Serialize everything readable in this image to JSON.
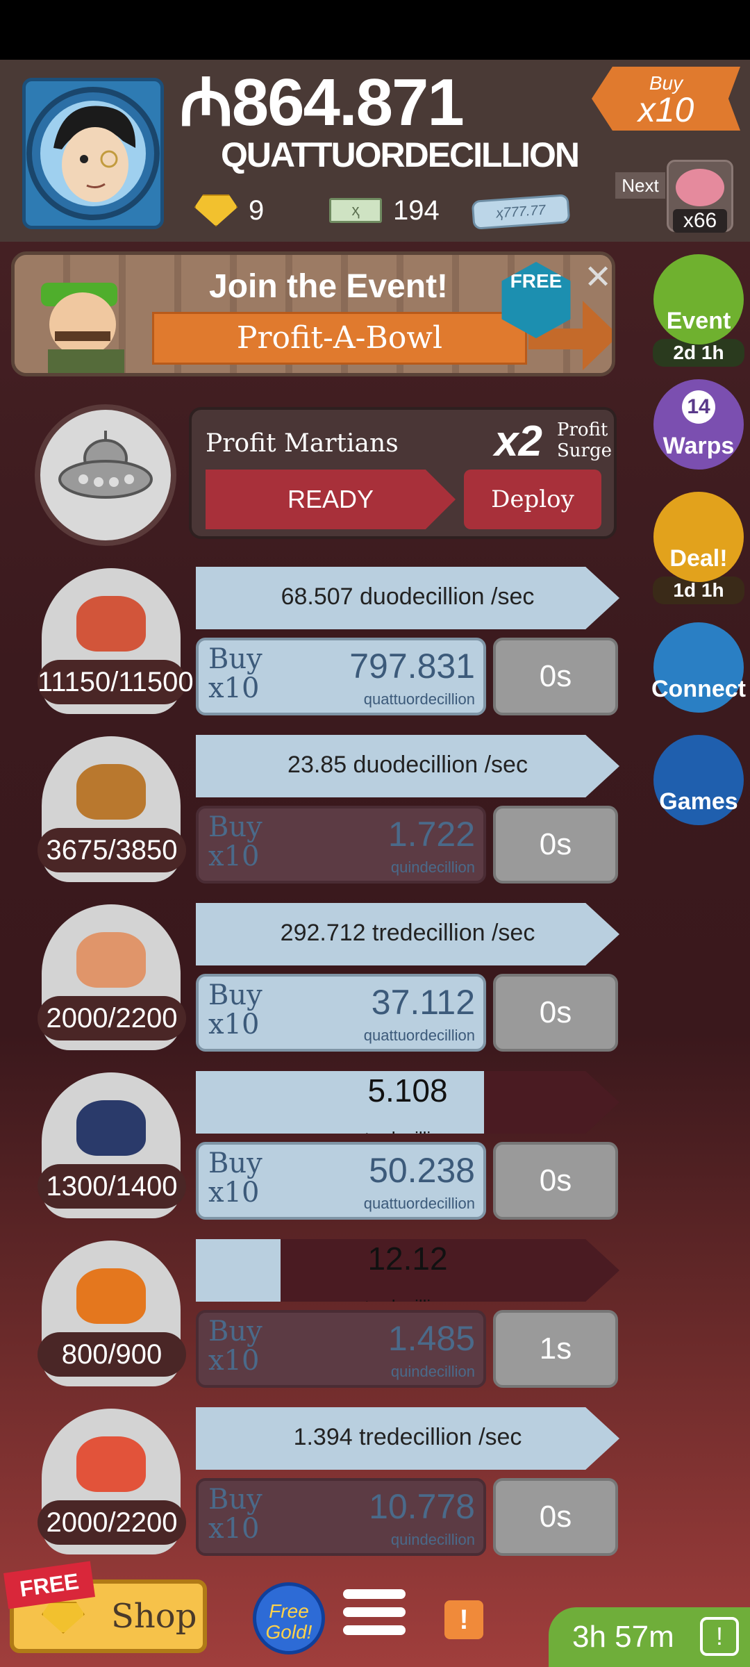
{
  "header": {
    "currency_symbol": "₼",
    "money_value": "864.871",
    "money_unit": "QUATTUORDECILLION",
    "gold_count": "9",
    "megabucks_count": "194",
    "angel_note": "ҳ777.77",
    "buy_multiplier_top": "Buy",
    "buy_multiplier_bottom": "x10",
    "next_label": "Next",
    "next_count": "x66"
  },
  "event_banner": {
    "title": "Join the Event!",
    "event_name": "Profit-A-Bowl",
    "free_label": "FREE",
    "close_glyph": "✕"
  },
  "side_buttons": [
    {
      "label": "Event",
      "timer": "2d 1h",
      "color": "#6fb12f"
    },
    {
      "label": "Warps",
      "badge": "14",
      "color": "#7b4fb0"
    },
    {
      "label": "Deal!",
      "timer": "1d 1h",
      "color": "#e2a21c"
    },
    {
      "label": "Connect",
      "color": "#2a7fc4"
    },
    {
      "label": "Games",
      "color": "#1f5fae"
    }
  ],
  "manager": {
    "name": "Profit Martians",
    "multiplier": "x2",
    "multiplier_label_1": "Profit",
    "multiplier_label_2": "Surge",
    "ready_label": "READY",
    "deploy_label": "Deploy"
  },
  "businesses": [
    {
      "count": "11150/11500",
      "rate": "68.507 duodecillion /sec",
      "mode": "rate",
      "buy_top": "Buy",
      "buy_bottom": "x10",
      "cost_value": "797.831",
      "cost_unit": "quattuordecillion",
      "time": "0s",
      "dim": false,
      "icon_color": "#d2553a"
    },
    {
      "count": "3675/3850",
      "rate": "23.85 duodecillion /sec",
      "mode": "rate",
      "buy_top": "Buy",
      "buy_bottom": "x10",
      "cost_value": "1.722",
      "cost_unit": "quindecillion",
      "time": "0s",
      "dim": true,
      "icon_color": "#b9782e"
    },
    {
      "count": "2000/2200",
      "rate": "292.712 tredecillion /sec",
      "mode": "rate",
      "buy_top": "Buy",
      "buy_bottom": "x10",
      "cost_value": "37.112",
      "cost_unit": "quattuordecillion",
      "time": "0s",
      "dim": false,
      "icon_color": "#e0956a"
    },
    {
      "count": "1300/1400",
      "rate_value": "5.108",
      "rate_unit": "tredecillion",
      "mode": "progress",
      "progress": 0.68,
      "buy_top": "Buy",
      "buy_bottom": "x10",
      "cost_value": "50.238",
      "cost_unit": "quattuordecillion",
      "time": "0s",
      "dim": false,
      "icon_color": "#2a3a6a"
    },
    {
      "count": "800/900",
      "rate_value": "12.12",
      "rate_unit": "tredecillion",
      "mode": "progress",
      "progress": 0.2,
      "buy_top": "Buy",
      "buy_bottom": "x10",
      "cost_value": "1.485",
      "cost_unit": "quindecillion",
      "time": "1s",
      "dim": true,
      "icon_color": "#e4771e"
    },
    {
      "count": "2000/2200",
      "rate": "1.394 tredecillion /sec",
      "mode": "rate",
      "buy_top": "Buy",
      "buy_bottom": "x10",
      "cost_value": "10.778",
      "cost_unit": "quindecillion",
      "time": "0s",
      "dim": true,
      "icon_color": "#e2533a"
    }
  ],
  "bottom_bar": {
    "free_flag": "FREE",
    "shop_label": "Shop",
    "free_gold_label_1": "Free",
    "free_gold_label_2": "Gold!",
    "alert_glyph": "!",
    "timer": "3h 57m"
  }
}
